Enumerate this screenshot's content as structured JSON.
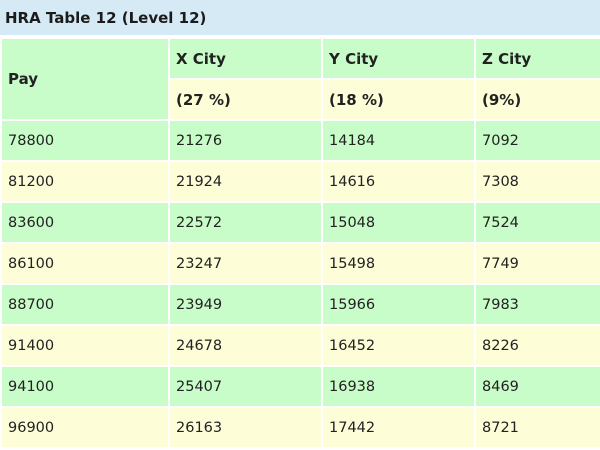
{
  "table": {
    "caption": "HRA Table 12 (Level 12)",
    "headers": {
      "pay": "Pay",
      "x_city": "X City",
      "y_city": "Y City",
      "z_city": "Z City",
      "x_rate": "(27 %)",
      "y_rate": "(18 %)",
      "z_rate": "(9%)"
    },
    "rows": [
      [
        "78800",
        "21276",
        "14184",
        "7092"
      ],
      [
        "81200",
        "21924",
        "14616",
        "7308"
      ],
      [
        "83600",
        "22572",
        "15048",
        "7524"
      ],
      [
        "86100",
        "23247",
        "15498",
        "7749"
      ],
      [
        "88700",
        "23949",
        "15966",
        "7983"
      ],
      [
        "91400",
        "24678",
        "16452",
        "8226"
      ],
      [
        "94100",
        "25407",
        "16938",
        "8469"
      ],
      [
        "96900",
        "26163",
        "17442",
        "8721"
      ]
    ],
    "colors": {
      "caption_bg": "#d6eaf6",
      "green_row": "#c8fcc8",
      "yellow_row": "#fdfdd8"
    }
  }
}
